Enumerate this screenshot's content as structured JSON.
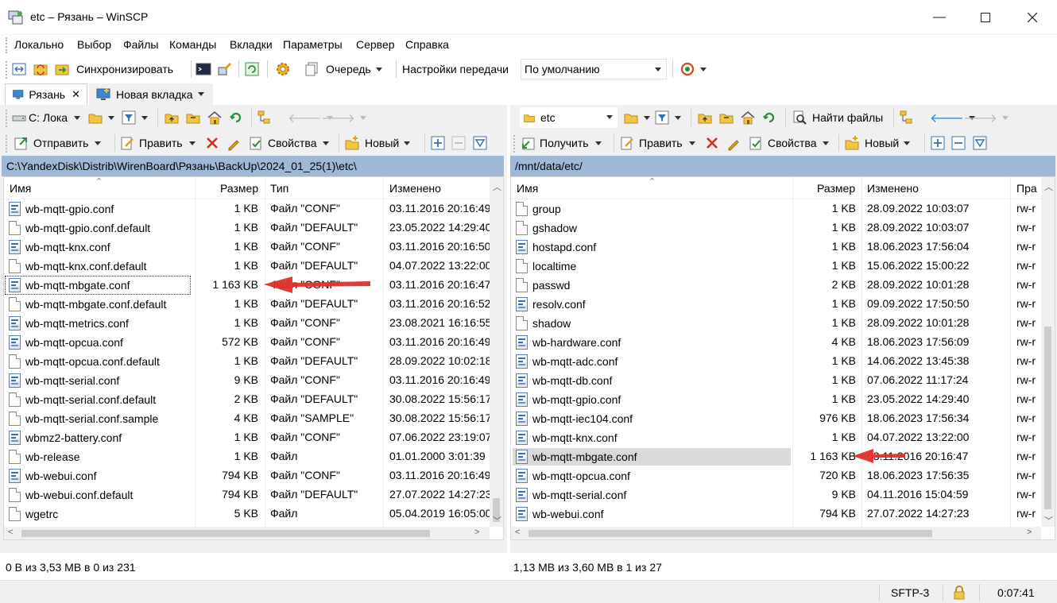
{
  "window": {
    "title": "etc – Рязань – WinSCP"
  },
  "menu": [
    "Локально",
    "Выбор",
    "Файлы",
    "Команды",
    "Вкладки",
    "Параметры",
    "Сервер",
    "Справка"
  ],
  "toolbar": {
    "sync_label": "Синхронизировать",
    "queue_label": "Очередь",
    "transfer_settings_label": "Настройки передачи",
    "transfer_preset": "По умолчанию"
  },
  "tabs": [
    {
      "label": "Рязань",
      "active": true
    },
    {
      "label": "Новая вкладка",
      "active": false
    }
  ],
  "left": {
    "drive": "C: Лока",
    "actions": {
      "send": "Отправить",
      "edit": "Править",
      "properties": "Свойства",
      "new": "Новый"
    },
    "path": "C:\\YandexDisk\\Distrib\\WirenBoard\\Рязань\\BackUp\\2024_01_25(1)\\etc\\",
    "columns": {
      "name": "Имя",
      "size": "Размер",
      "type": "Тип",
      "modified": "Изменено"
    },
    "files": [
      {
        "name": "wb-mqtt-gpio.conf",
        "size": "1 KB",
        "type": "Файл \"CONF\"",
        "modified": "03.11.2016 20:16:49",
        "icon": "conf"
      },
      {
        "name": "wb-mqtt-gpio.conf.default",
        "size": "1 KB",
        "type": "Файл \"DEFAULT\"",
        "modified": "23.05.2022 14:29:40",
        "icon": "plain"
      },
      {
        "name": "wb-mqtt-knx.conf",
        "size": "1 KB",
        "type": "Файл \"CONF\"",
        "modified": "03.11.2016 20:16:50",
        "icon": "conf"
      },
      {
        "name": "wb-mqtt-knx.conf.default",
        "size": "1 KB",
        "type": "Файл \"DEFAULT\"",
        "modified": "04.07.2022 13:22:00",
        "icon": "plain"
      },
      {
        "name": "wb-mqtt-mbgate.conf",
        "size": "1 163 KB",
        "type": "Файл \"CONF\"",
        "modified": "03.11.2016 20:16:47",
        "icon": "conf",
        "focus": true
      },
      {
        "name": "wb-mqtt-mbgate.conf.default",
        "size": "1 KB",
        "type": "Файл \"DEFAULT\"",
        "modified": "03.11.2016 20:16:52",
        "icon": "plain"
      },
      {
        "name": "wb-mqtt-metrics.conf",
        "size": "1 KB",
        "type": "Файл \"CONF\"",
        "modified": "23.08.2021 16:16:55",
        "icon": "conf"
      },
      {
        "name": "wb-mqtt-opcua.conf",
        "size": "572 KB",
        "type": "Файл \"CONF\"",
        "modified": "03.11.2016 20:16:49",
        "icon": "conf"
      },
      {
        "name": "wb-mqtt-opcua.conf.default",
        "size": "1 KB",
        "type": "Файл \"DEFAULT\"",
        "modified": "28.09.2022 10:02:18",
        "icon": "plain"
      },
      {
        "name": "wb-mqtt-serial.conf",
        "size": "9 KB",
        "type": "Файл \"CONF\"",
        "modified": "03.11.2016 20:16:49",
        "icon": "conf"
      },
      {
        "name": "wb-mqtt-serial.conf.default",
        "size": "2 KB",
        "type": "Файл \"DEFAULT\"",
        "modified": "30.08.2022 15:56:17",
        "icon": "plain"
      },
      {
        "name": "wb-mqtt-serial.conf.sample",
        "size": "4 KB",
        "type": "Файл \"SAMPLE\"",
        "modified": "30.08.2022 15:56:17",
        "icon": "plain"
      },
      {
        "name": "wbmz2-battery.conf",
        "size": "1 KB",
        "type": "Файл \"CONF\"",
        "modified": "07.06.2022 23:19:07",
        "icon": "conf"
      },
      {
        "name": "wb-release",
        "size": "1 KB",
        "type": "Файл",
        "modified": "01.01.2000 3:01:39",
        "icon": "plain"
      },
      {
        "name": "wb-webui.conf",
        "size": "794 KB",
        "type": "Файл \"CONF\"",
        "modified": "03.11.2016 20:16:49",
        "icon": "conf"
      },
      {
        "name": "wb-webui.conf.default",
        "size": "794 KB",
        "type": "Файл \"DEFAULT\"",
        "modified": "27.07.2022 14:27:23",
        "icon": "plain"
      },
      {
        "name": "wgetrc",
        "size": "5 KB",
        "type": "Файл",
        "modified": "05.04.2019 16:05:00",
        "icon": "plain"
      }
    ],
    "status": "0 B из 3,53 MB в 0 из 231"
  },
  "right": {
    "dir": "etc",
    "find_files": "Найти файлы",
    "actions": {
      "receive": "Получить",
      "edit": "Править",
      "properties": "Свойства",
      "new": "Новый"
    },
    "path": "/mnt/data/etc/",
    "columns": {
      "name": "Имя",
      "size": "Размер",
      "modified": "Изменено",
      "rights": "Пра"
    },
    "files": [
      {
        "name": "group",
        "size": "1 KB",
        "modified": "28.09.2022 10:03:07",
        "rights": "rw-r",
        "icon": "plain"
      },
      {
        "name": "gshadow",
        "size": "1 KB",
        "modified": "28.09.2022 10:03:07",
        "rights": "rw-r",
        "icon": "plain"
      },
      {
        "name": "hostapd.conf",
        "size": "1 KB",
        "modified": "18.06.2023 17:56:04",
        "rights": "rw-r",
        "icon": "conf"
      },
      {
        "name": "localtime",
        "size": "1 KB",
        "modified": "15.06.2022 15:00:22",
        "rights": "rw-r",
        "icon": "plain"
      },
      {
        "name": "passwd",
        "size": "2 KB",
        "modified": "28.09.2022 10:01:28",
        "rights": "rw-r",
        "icon": "plain"
      },
      {
        "name": "resolv.conf",
        "size": "1 KB",
        "modified": "09.09.2022 17:50:50",
        "rights": "rw-r",
        "icon": "conf"
      },
      {
        "name": "shadow",
        "size": "1 KB",
        "modified": "28.09.2022 10:01:28",
        "rights": "rw-r",
        "icon": "plain"
      },
      {
        "name": "wb-hardware.conf",
        "size": "4 KB",
        "modified": "18.06.2023 17:56:09",
        "rights": "rw-r",
        "icon": "conf"
      },
      {
        "name": "wb-mqtt-adc.conf",
        "size": "1 KB",
        "modified": "14.06.2022 13:45:38",
        "rights": "rw-r",
        "icon": "conf"
      },
      {
        "name": "wb-mqtt-db.conf",
        "size": "1 KB",
        "modified": "07.06.2022 11:17:24",
        "rights": "rw-r",
        "icon": "conf"
      },
      {
        "name": "wb-mqtt-gpio.conf",
        "size": "1 KB",
        "modified": "23.05.2022 14:29:40",
        "rights": "rw-r",
        "icon": "conf"
      },
      {
        "name": "wb-mqtt-iec104.conf",
        "size": "976 KB",
        "modified": "18.06.2023 17:56:34",
        "rights": "rw-r",
        "icon": "conf"
      },
      {
        "name": "wb-mqtt-knx.conf",
        "size": "1 KB",
        "modified": "04.07.2022 13:22:00",
        "rights": "rw-r",
        "icon": "conf"
      },
      {
        "name": "wb-mqtt-mbgate.conf",
        "size": "1 163 KB",
        "modified": "03.11.2016 20:16:47",
        "rights": "rw-r",
        "icon": "conf",
        "selected": true
      },
      {
        "name": "wb-mqtt-opcua.conf",
        "size": "720 KB",
        "modified": "18.06.2023 17:56:35",
        "rights": "rw-r",
        "icon": "conf"
      },
      {
        "name": "wb-mqtt-serial.conf",
        "size": "9 KB",
        "modified": "04.11.2016 15:04:59",
        "rights": "rw-r",
        "icon": "conf"
      },
      {
        "name": "wb-webui.conf",
        "size": "794 KB",
        "modified": "27.07.2022 14:27:23",
        "rights": "rw-r",
        "icon": "conf"
      }
    ],
    "status": "1,13 MB из 3,60 MB в 1 из 27"
  },
  "statusbar": {
    "protocol": "SFTP-3",
    "elapsed": "0:07:41"
  },
  "colors": {
    "path_bar": "#9fb8d5",
    "annotation_arrow": "#e0302a",
    "selection": "#d9d9d9"
  }
}
